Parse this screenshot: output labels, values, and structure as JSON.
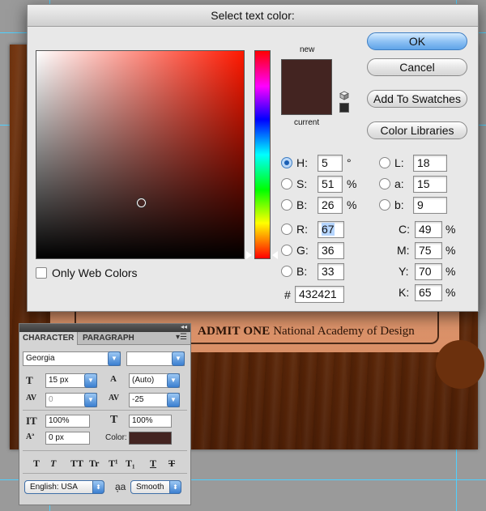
{
  "dialog": {
    "title": "Select text color:",
    "new_label": "new",
    "current_label": "current",
    "only_web_colors_label": "Only Web Colors",
    "buttons": {
      "ok": "OK",
      "cancel": "Cancel",
      "add_to_swatches": "Add To Swatches",
      "color_libraries": "Color Libraries"
    },
    "hsb": {
      "h": {
        "label": "H:",
        "value": "5",
        "unit": "°",
        "selected": true
      },
      "s": {
        "label": "S:",
        "value": "51",
        "unit": "%"
      },
      "b": {
        "label": "B:",
        "value": "26",
        "unit": "%"
      }
    },
    "rgb": {
      "r": {
        "label": "R:",
        "value": "67"
      },
      "g": {
        "label": "G:",
        "value": "36"
      },
      "b": {
        "label": "B:",
        "value": "33"
      }
    },
    "lab": {
      "l": {
        "label": "L:",
        "value": "18"
      },
      "a": {
        "label": "a:",
        "value": "15"
      },
      "b": {
        "label": "b:",
        "value": "9"
      }
    },
    "cmyk": {
      "c": {
        "label": "C:",
        "value": "49",
        "unit": "%"
      },
      "m": {
        "label": "M:",
        "value": "75",
        "unit": "%"
      },
      "y": {
        "label": "Y:",
        "value": "70",
        "unit": "%"
      },
      "k": {
        "label": "K:",
        "value": "65",
        "unit": "%"
      }
    },
    "hex": {
      "label": "#",
      "value": "432421"
    },
    "new_color": "#432421",
    "current_color": "#2a2a2a"
  },
  "canvas": {
    "ticket_text_bold": "ADMIT ONE",
    "ticket_text": "National Academy of Design"
  },
  "character_panel": {
    "tabs": [
      "CHARACTER",
      "PARAGRAPH"
    ],
    "font_family": "Georgia",
    "font_style": "",
    "font_size": "15 px",
    "leading": "(Auto)",
    "kerning": "0",
    "tracking": "-25",
    "vertical_scale": "100%",
    "horizontal_scale": "100%",
    "baseline_shift": "0 px",
    "color_label": "Color:",
    "text_color": "#432421",
    "style_buttons": [
      "T",
      "T",
      "TT",
      "Tr",
      "T¹",
      "T₁",
      "T",
      "T"
    ],
    "language": "English: USA",
    "aa_label": "a͎a",
    "anti_alias": "Smooth"
  }
}
